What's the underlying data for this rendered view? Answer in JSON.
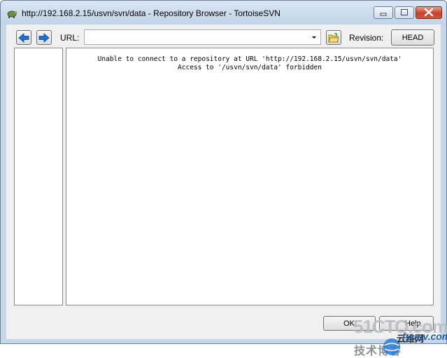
{
  "window": {
    "title": "http://192.168.2.15/usvn/svn/data - Repository Browser - TortoiseSVN"
  },
  "toolbar": {
    "url_label": "URL:",
    "url_value": "",
    "revision_label": "Revision:",
    "head_button": "HEAD"
  },
  "content": {
    "message_line1": "Unable to connect to a repository at URL 'http://192.168.2.15/usvn/svn/data'",
    "message_line2": "Access to '/usvn/svn/data' forbidden"
  },
  "footer": {
    "ok_button": "OK",
    "help_button": "Help"
  },
  "watermark": {
    "site": "51CTO.com",
    "slogan": "技术博客",
    "brand": "fyunv.com",
    "brand_cn": "云维网"
  },
  "colors": {
    "accent_arrow": "#1f6fd1",
    "close_button": "#c4422b",
    "frame": "#c5d6e8"
  }
}
